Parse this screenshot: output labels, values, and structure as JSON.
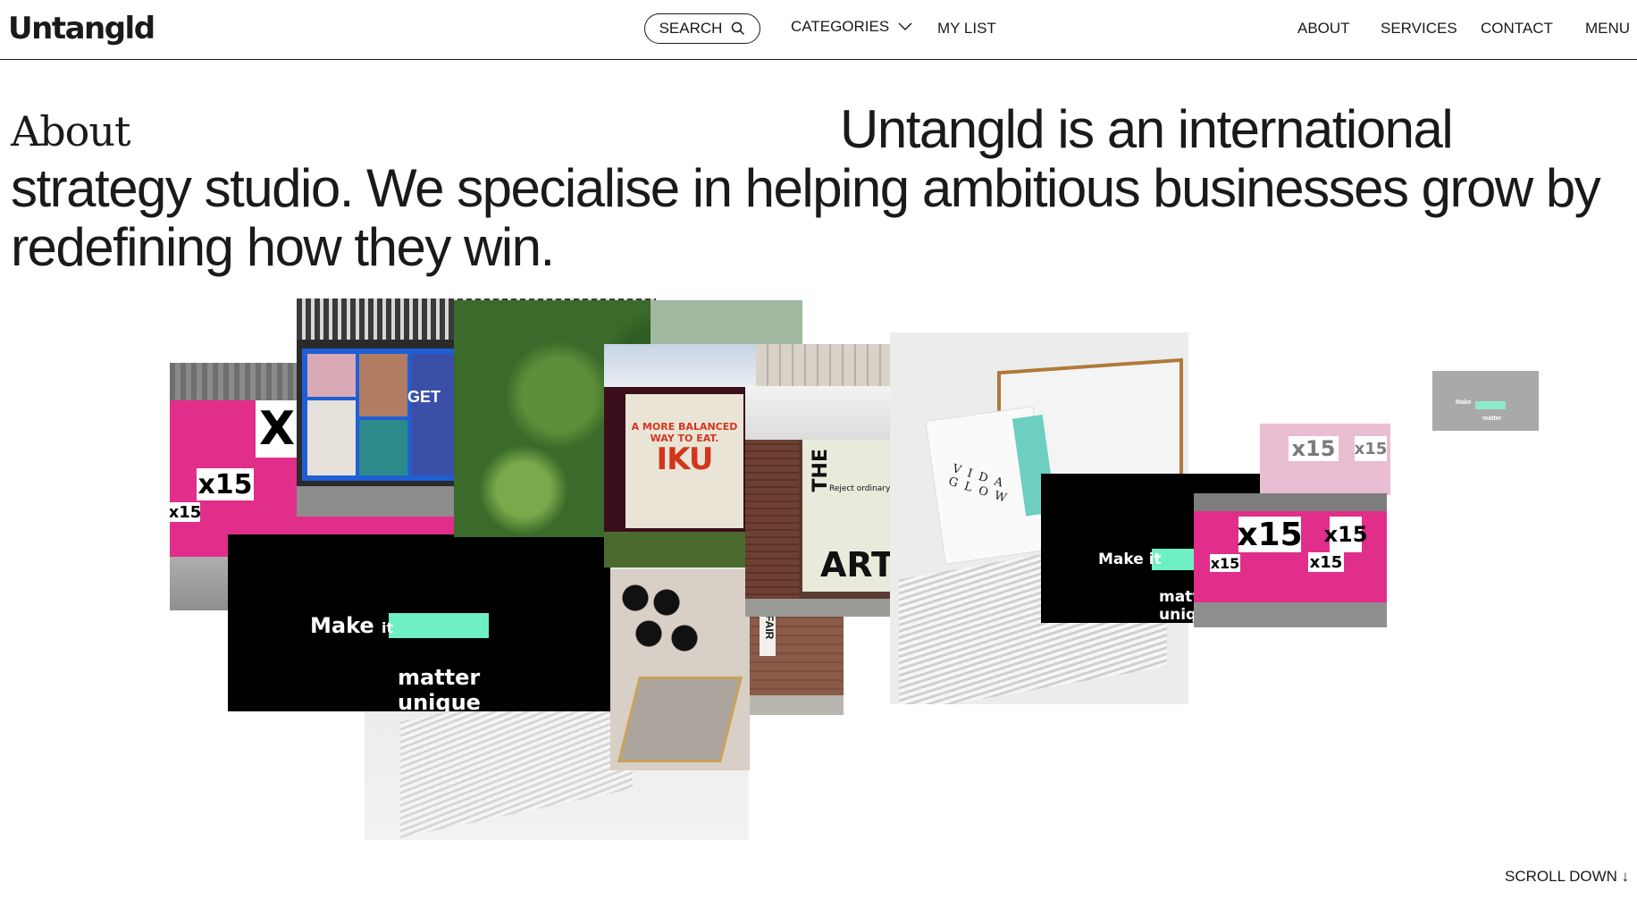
{
  "header": {
    "logo": "Untangld",
    "search_label": "SEARCH",
    "categories_label": "CATEGORIES",
    "my_list_label": "MY LIST",
    "nav": {
      "about": "ABOUT",
      "services": "SERVICES",
      "contact": "CONTACT",
      "menu": "MENU"
    },
    "icons": {
      "search": "search-icon",
      "categories": "chevron-down-icon"
    }
  },
  "main": {
    "section_label": "About",
    "intro": "Untangld is an international strategy studio. We specialise in helping ambitious businesses grow by redefining how they win."
  },
  "collage": {
    "x15_mark": "x15",
    "x15_small": "x15",
    "get_text": "GET",
    "iku_small": "A MORE BALANCED WAY TO EAT.",
    "iku_big": "IKU",
    "the_text": "THE",
    "art_text": "ART",
    "reject_text": "Reject ordinary",
    "fair_text": "FAIR",
    "vida_text": "VIDA GLOW",
    "make_text": "Make",
    "it_text": "it",
    "matter_text": "matter",
    "unique_text": "unique",
    "accent_pink": "#e12e8a",
    "accent_mint": "#6ef0c4"
  },
  "footer": {
    "scroll_down": "SCROLL DOWN ↓"
  }
}
